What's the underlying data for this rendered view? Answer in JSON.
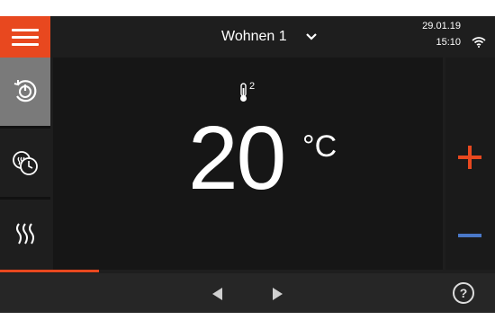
{
  "header": {
    "room_title": "Wohnen 1",
    "date": "29.01.19",
    "time": "15:10"
  },
  "sidebar": {
    "items": [
      {
        "icon": "power-cycle-icon",
        "active": true
      },
      {
        "icon": "heating-schedule-icon",
        "active": false
      },
      {
        "icon": "heating-icon",
        "active": false
      }
    ]
  },
  "main": {
    "sensor_number": "2",
    "temperature": "20",
    "unit": "°C"
  },
  "controls": {
    "plus_color": "#e8481f",
    "minus_color": "#4a78c8"
  },
  "progress": {
    "fraction": 0.2
  },
  "footer": {
    "help_label": "?"
  },
  "colors": {
    "accent": "#e8481f",
    "background": "#1e1e1e"
  }
}
